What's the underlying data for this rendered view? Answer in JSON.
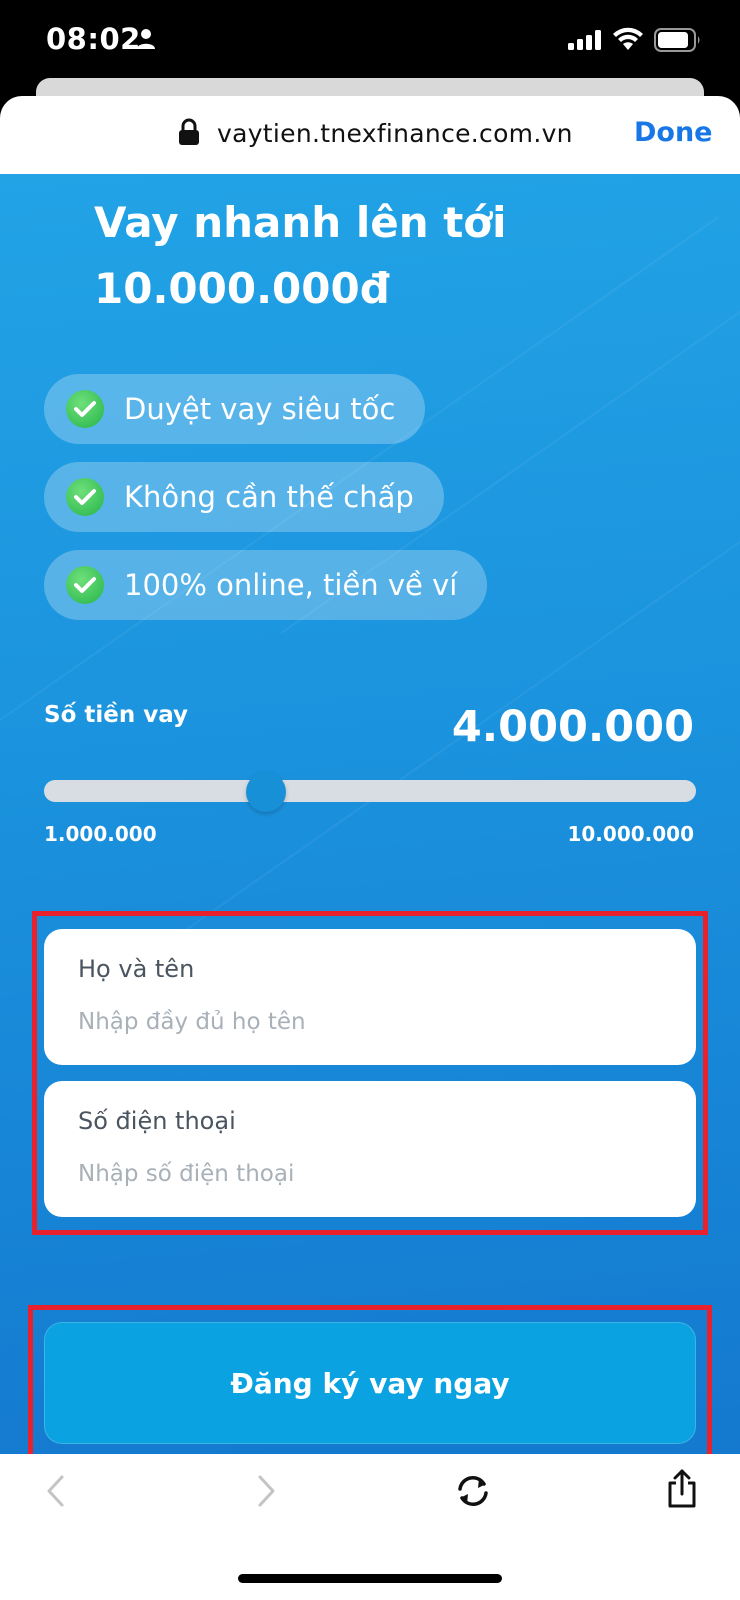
{
  "status_bar": {
    "time": "08:02"
  },
  "browser": {
    "url": "vaytien.tnexfinance.com.vn",
    "done_label": "Done"
  },
  "hero": {
    "title_line1": "Vay nhanh lên tới",
    "title_line2": "10.000.000đ"
  },
  "features": [
    {
      "label": "Duyệt vay siêu tốc",
      "icon": "check-icon"
    },
    {
      "label": "Không cần thế chấp",
      "icon": "check-icon"
    },
    {
      "label": "100% online, tiền về ví",
      "icon": "check-icon"
    }
  ],
  "loan": {
    "label": "Số tiền vay",
    "value": "4.000.000",
    "min_label": "1.000.000",
    "max_label": "10.000.000",
    "slider_fraction": 0.34
  },
  "form": {
    "name_label": "Họ và tên",
    "name_placeholder": "Nhập đầy đủ họ tên",
    "phone_label": "Số điện thoại",
    "phone_placeholder": "Nhập số điện thoại"
  },
  "submit_label": "Đăng ký vay ngay",
  "colors": {
    "highlight_outline": "#e8212c",
    "accent": "#1877e6",
    "button": "#0aa2e0"
  }
}
